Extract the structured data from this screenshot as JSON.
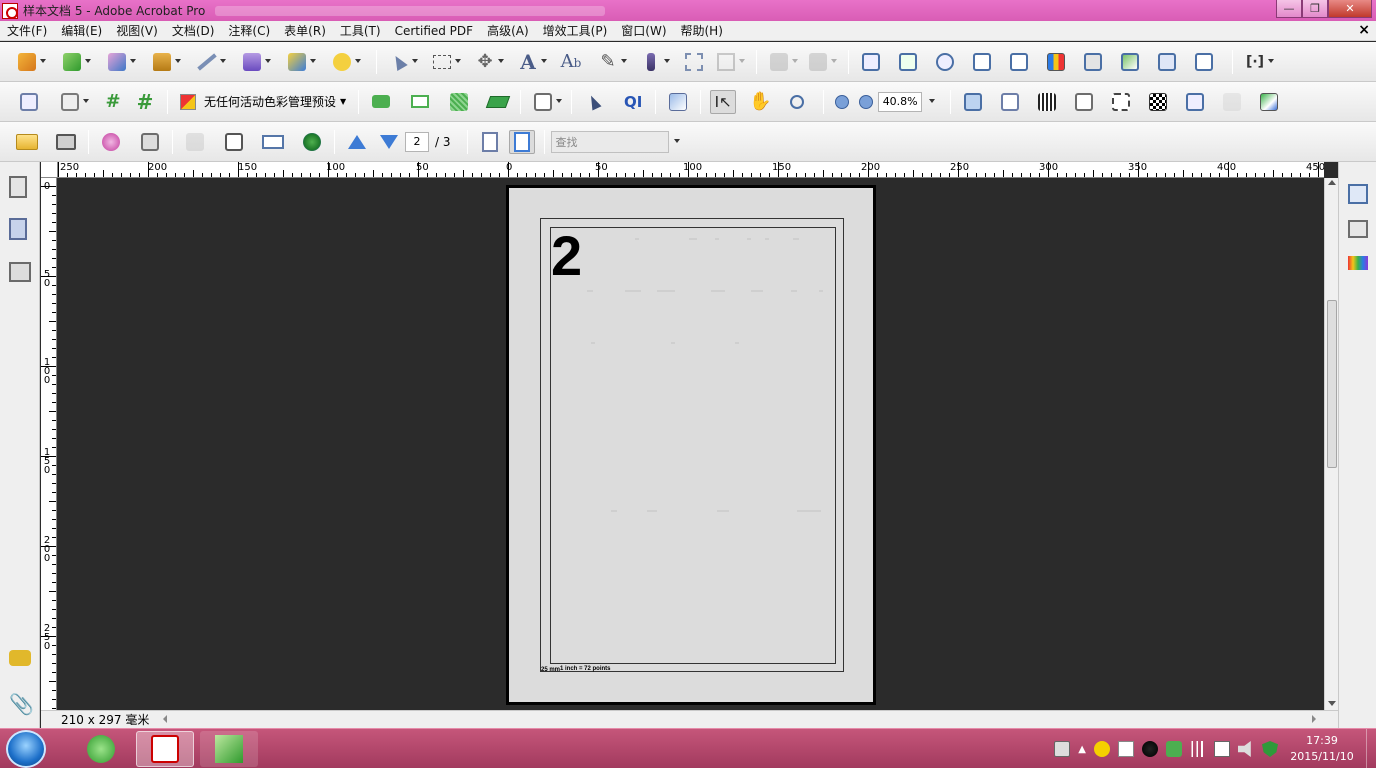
{
  "window": {
    "title": "样本文档 5 - Adobe Acrobat Pro",
    "controls": {
      "minimize": "—",
      "maximize": "❐",
      "close": "✕"
    }
  },
  "menubar": {
    "items": [
      "文件(F)",
      "编辑(E)",
      "视图(V)",
      "文档(D)",
      "注释(C)",
      "表单(R)",
      "工具(T)",
      "Certified PDF",
      "高级(A)",
      "增效工具(P)",
      "窗口(W)",
      "帮助(H)"
    ],
    "close": "×"
  },
  "toolbar2": {
    "color_preset": "无任何活动色彩管理预设",
    "zoom": "40.8%"
  },
  "toolbar3": {
    "page_current": "2",
    "page_total": "/ 3",
    "search_placeholder": "查找"
  },
  "ruler_top": {
    "labels": [
      "250",
      "200",
      "150",
      "100",
      "50",
      "0",
      "50",
      "100",
      "150",
      "200",
      "250",
      "300",
      "350",
      "400",
      "450"
    ]
  },
  "ruler_left": {
    "labels": [
      "0",
      "50",
      "100",
      "150",
      "200",
      "250"
    ]
  },
  "document": {
    "page_number": "2",
    "foot_line1": "1 inch = 72 points",
    "foot_line2": "25 mm"
  },
  "status": {
    "page_size": "210 x 297 毫米"
  },
  "clock": {
    "time": "17:39",
    "date": "2015/11/10"
  },
  "colors": {
    "titlebar": "#e06bbf",
    "taskbar": "#b44a6e",
    "workspace": "#2b2b2b",
    "page": "#dcdcdc"
  }
}
